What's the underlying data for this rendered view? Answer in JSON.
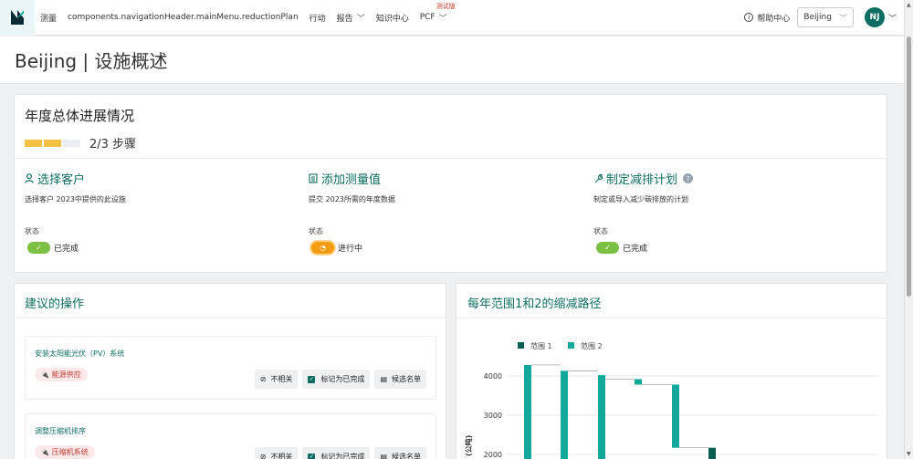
{
  "nav": {
    "logo_label": "测量",
    "items": [
      {
        "label": "components.navigationHeader.mainMenu.reductionPlan",
        "dropdown": false
      },
      {
        "label": "行动",
        "dropdown": false
      },
      {
        "label": "报告",
        "dropdown": true
      },
      {
        "label": "知识中心",
        "dropdown": false
      },
      {
        "label": "PCF",
        "dropdown": true,
        "badge": "测试版"
      }
    ],
    "help_label": "帮助中心",
    "location_value": "Beijing",
    "avatar_initials": "NJ"
  },
  "page": {
    "title": "Beijing | 设施概述"
  },
  "annual": {
    "title": "年度总体进展情况",
    "progress_text": "2/3 步骤",
    "steps_done": 2,
    "steps_total": 3,
    "status_label": "状态",
    "steps": [
      {
        "title": "选择客户",
        "icon": "user-icon",
        "desc": "选择客户 2023中提供的此设施",
        "status": "已完成",
        "state": "done"
      },
      {
        "title": "添加测量值",
        "icon": "list-icon",
        "desc": "提交 2023所需的年度数据",
        "status": "进行中",
        "state": "progress"
      },
      {
        "title": "制定减排计划",
        "icon": "wrench-icon",
        "desc": "制定或导入减少碳排放的计划",
        "status": "已完成",
        "state": "done",
        "help": true
      }
    ]
  },
  "actions": {
    "title": "建议的操作",
    "items": [
      {
        "title": "安装太阳能光伏（PV）系统",
        "tag": "能源供应"
      },
      {
        "title": "调整压缩机排序",
        "tag": "压缩机系统"
      }
    ],
    "buttons": {
      "irrelevant": "不相关",
      "mark_done": "标记为已完成",
      "shortlist": "候选名单"
    }
  },
  "chart_section": {
    "title": "每年范围1和2的缩减路径"
  },
  "chart_data": {
    "type": "bar",
    "legend": [
      {
        "name": "范围 1",
        "color": "#0b5d52"
      },
      {
        "name": "范围 2",
        "color": "#14a89a"
      }
    ],
    "ylabel": "(公吨)",
    "yticks": [
      2000,
      3000,
      4000
    ],
    "ylim": [
      1600,
      4600
    ],
    "bars": [
      {
        "bottom": 1600,
        "top": 4280,
        "series": "范围 2"
      },
      {
        "bottom": 1600,
        "top": 4130,
        "series": "范围 2"
      },
      {
        "bottom": 1600,
        "top": 4020,
        "series": "范围 2"
      },
      {
        "bottom": 3780,
        "top": 3920,
        "series": "范围 2"
      },
      {
        "bottom": 2170,
        "top": 3780,
        "series": "范围 2"
      },
      {
        "bottom": 1600,
        "top": 2170,
        "series": "范围 1"
      }
    ],
    "legend_placement": "top-left",
    "grid": true
  }
}
